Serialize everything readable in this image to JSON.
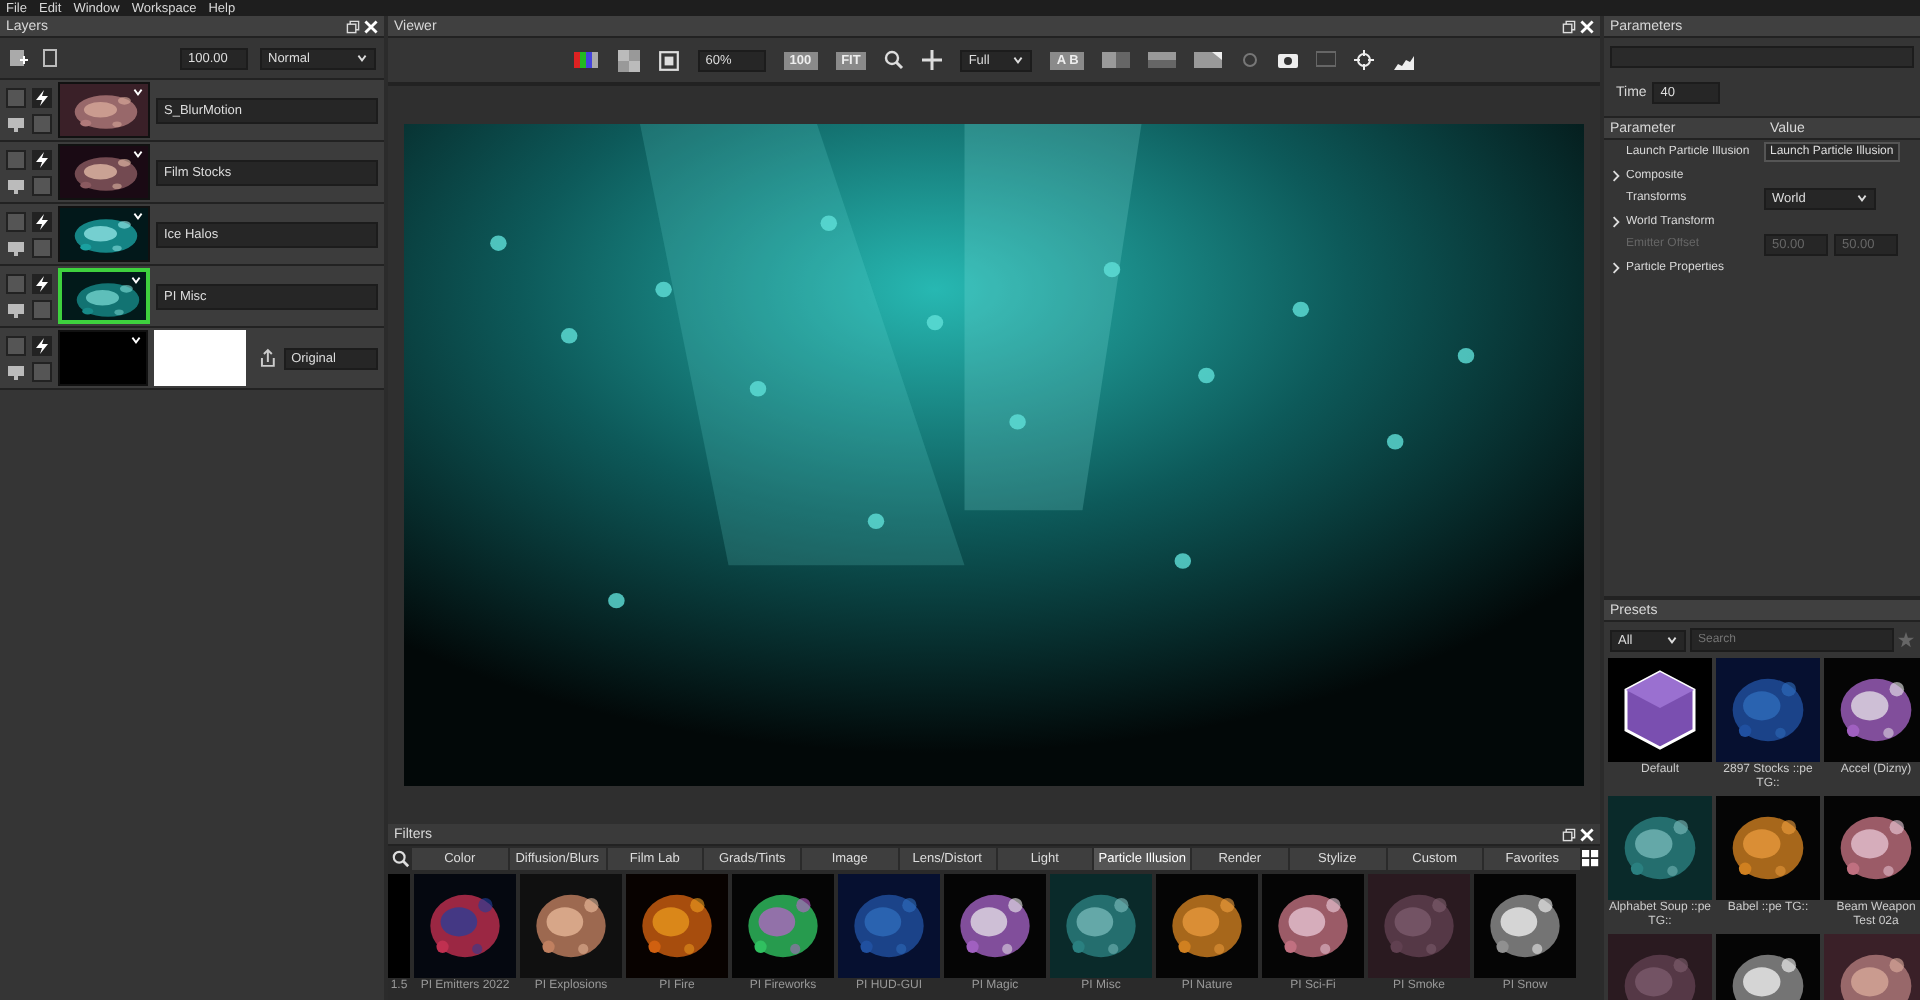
{
  "menu": [
    "File",
    "Edit",
    "Window",
    "Workspace",
    "Help"
  ],
  "layers": {
    "title": "Layers",
    "opacity": "100.00",
    "blend": "Normal",
    "items": [
      {
        "kind": "effect",
        "name": "S_BlurMotion",
        "selected": false
      },
      {
        "kind": "effect",
        "name": "Film Stocks",
        "selected": false
      },
      {
        "kind": "effect",
        "name": "Ice Halos",
        "selected": false
      },
      {
        "kind": "effect",
        "name": "PI Misc",
        "selected": true
      },
      {
        "kind": "matte",
        "name": "Original",
        "selected": false
      }
    ]
  },
  "viewer": {
    "title": "Viewer",
    "zoom": "60%",
    "actual": "100",
    "fit": "FIT",
    "resolution": "Full",
    "compare": "A B"
  },
  "filters": {
    "title": "Filters",
    "tabs": [
      {
        "label": "Color",
        "selected": false
      },
      {
        "label": "Diffusion/Blurs",
        "selected": false
      },
      {
        "label": "Film Lab",
        "selected": false
      },
      {
        "label": "Grads/Tints",
        "selected": false
      },
      {
        "label": "Image",
        "selected": false
      },
      {
        "label": "Lens/Distort",
        "selected": false
      },
      {
        "label": "Light",
        "selected": false
      },
      {
        "label": "Particle Illusion",
        "selected": true
      },
      {
        "label": "Render",
        "selected": false
      },
      {
        "label": "Stylize",
        "selected": false
      },
      {
        "label": "Custom",
        "selected": false
      },
      {
        "label": "Favorites",
        "selected": false
      }
    ],
    "items": [
      {
        "kind": "partial",
        "label": "1.5"
      },
      {
        "kind": "full",
        "label": "PI Emitters 2022"
      },
      {
        "kind": "full",
        "label": "PI Explosions"
      },
      {
        "kind": "full",
        "label": "PI Fire"
      },
      {
        "kind": "full",
        "label": "PI Fireworks"
      },
      {
        "kind": "full",
        "label": "PI HUD-GUI"
      },
      {
        "kind": "full",
        "label": "PI Magic"
      },
      {
        "kind": "full",
        "label": "PI Misc"
      },
      {
        "kind": "full",
        "label": "PI Nature"
      },
      {
        "kind": "full",
        "label": "PI Sci-Fi"
      },
      {
        "kind": "full",
        "label": "PI Smoke"
      },
      {
        "kind": "full",
        "label": "PI Snow"
      }
    ]
  },
  "parameters": {
    "title": "Parameters",
    "time_label": "Time",
    "time": "40",
    "columns": [
      "Parameter",
      "Value"
    ],
    "rows": [
      {
        "kind": "button",
        "label": "Launch Particle Illusion",
        "value": "Launch Particle Illusion",
        "disabled": false
      },
      {
        "kind": "group",
        "label": "Composite",
        "disabled": false
      },
      {
        "kind": "select",
        "label": "Transforms",
        "value": "World",
        "disabled": false
      },
      {
        "kind": "group",
        "label": "World Transform",
        "disabled": false
      },
      {
        "kind": "pair",
        "label": "Emitter Offset",
        "values": [
          "50.00",
          "50.00"
        ],
        "disabled": true
      },
      {
        "kind": "group",
        "label": "Particle Properties",
        "disabled": false
      }
    ]
  },
  "presets": {
    "title": "Presets",
    "filter": "All",
    "placeholder": "Search",
    "items": [
      {
        "kind": "logo",
        "label": "Default"
      },
      {
        "kind": "picture",
        "label": "2897 Stocks ::pe TG::"
      },
      {
        "kind": "picture",
        "label": "Accel (Dizny)"
      },
      {
        "kind": "picture",
        "label": "Alphabet Soup ::pe TG::"
      },
      {
        "kind": "picture",
        "label": "Babel ::pe TG::"
      },
      {
        "kind": "picture",
        "label": "Beam Weapon Test 02a"
      },
      {
        "kind": "picture"
      },
      {
        "kind": "picture"
      },
      {
        "kind": "picture"
      }
    ]
  }
}
